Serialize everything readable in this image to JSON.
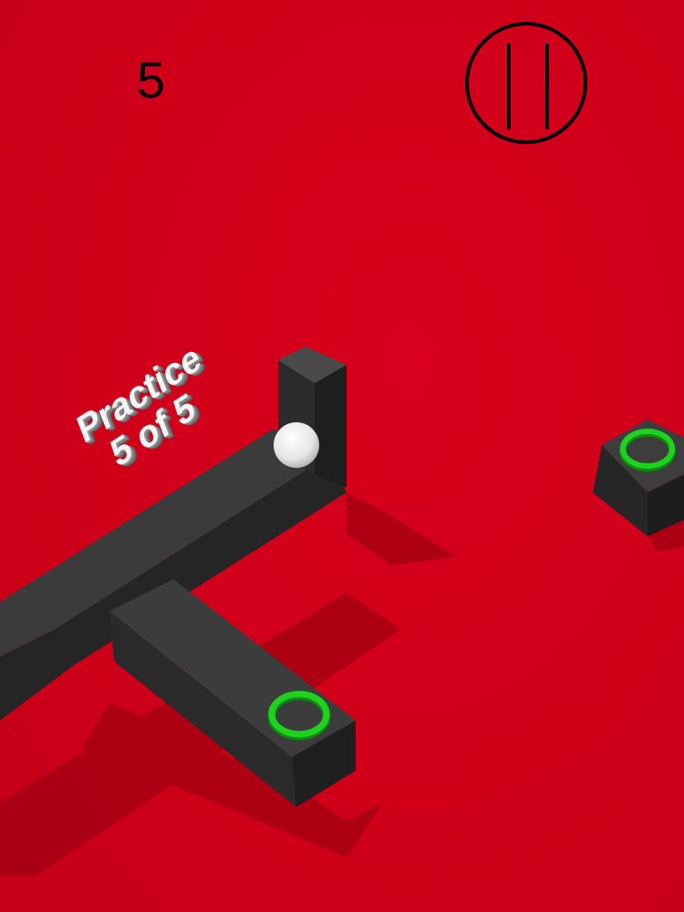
{
  "hud": {
    "score": "5",
    "pause_icon": "pause-icon"
  },
  "level_label": {
    "line1": "Practice",
    "line2": "5 of 5"
  },
  "colors": {
    "background": "#d3001b",
    "platform_top": "#3a3a3a",
    "platform_side": "#262626",
    "shadow": "#a20012",
    "ring": "#1fd21f",
    "ball": "#f2f2f2"
  }
}
